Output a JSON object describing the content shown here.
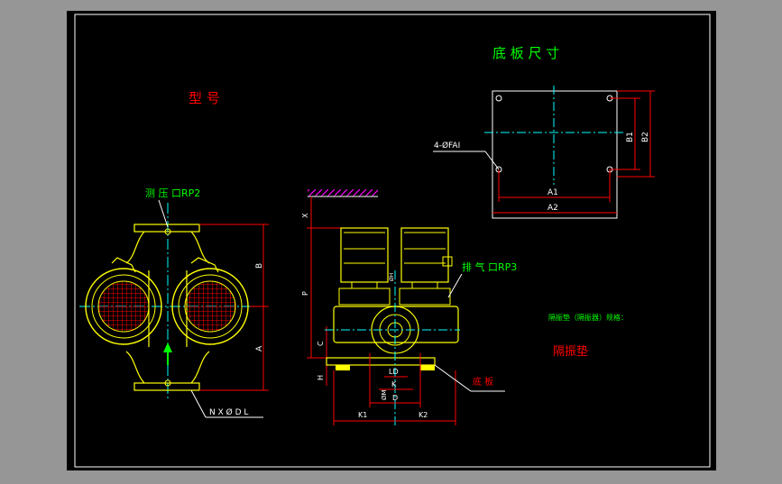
{
  "colors": {
    "background": "#969696",
    "frame": "#ffffff",
    "paper": "#000000",
    "pump_body": "#ffff00",
    "dimension": "#ff0000",
    "centerline": "#00ffff",
    "note_green": "#00ff00",
    "note_red": "#ff0000",
    "leader": "#ffffff"
  },
  "drawing": {
    "model_title": "型 号",
    "base_title": "底 板 尺 寸",
    "pressure_port": "测 压 口RP2",
    "vent_port": "排 气 口RP3",
    "bolt_note": "N X Ø D L",
    "holes_note": "4-ØFAI",
    "isolator_spec": "隔振垫（隔振器）规格：",
    "isolator_label": "隔振垫",
    "base_label": "底 板",
    "dims": {
      "a": "A",
      "b": "B",
      "a1": "A1",
      "a2": "A2",
      "b1": "B1",
      "b2": "B2",
      "p": "P",
      "x": "X",
      "c": "C",
      "h": "H",
      "k1": "K1",
      "k2": "K2",
      "k": "K",
      "d": "D",
      "ld": "LD",
      "dm": "ØM",
      "dh": "ØH"
    }
  }
}
